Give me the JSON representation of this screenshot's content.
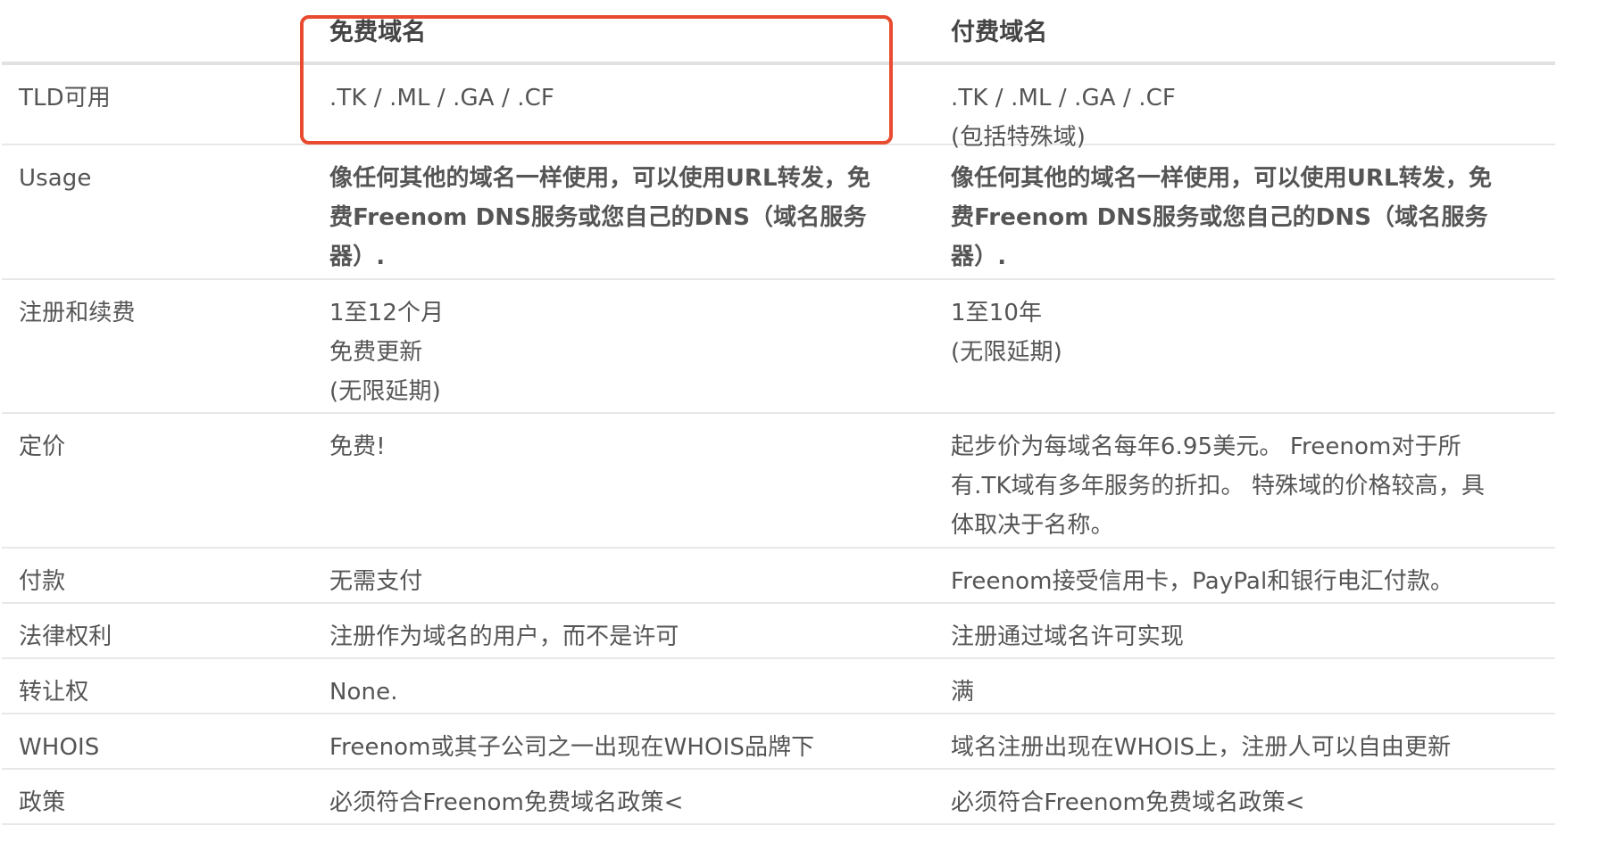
{
  "headers": {
    "label": "",
    "free": "免费域名",
    "paid": "付费域名"
  },
  "rows": [
    {
      "label": "TLD可用",
      "free": [
        ".TK / .ML / .GA / .CF"
      ],
      "paid": [
        ".TK / .ML / .GA / .CF",
        "(包括特殊域)"
      ]
    },
    {
      "label": "Usage",
      "free": [
        "像任何其他的域名一样使用，可以使用URL转发，免",
        "费Freenom DNS服务或您自己的DNS（域名服务",
        "器）."
      ],
      "paid": [
        "像任何其他的域名一样使用，可以使用URL转发，免",
        "费Freenom DNS服务或您自己的DNS（域名服务",
        "器）."
      ]
    },
    {
      "label": "注册和续费",
      "free": [
        "1至12个月",
        "免费更新",
        "(无限延期)"
      ],
      "paid": [
        "1至10年",
        "(无限延期)"
      ]
    },
    {
      "label": "定价",
      "free": [
        "免费!"
      ],
      "paid": [
        "起步价为每域名每年6.95美元。 Freenom对于所",
        "有.TK域有多年服务的折扣。 特殊域的价格较高，具",
        "体取决于名称。"
      ]
    },
    {
      "label": "付款",
      "free": [
        "无需支付"
      ],
      "paid": [
        "Freenom接受信用卡，PayPal和银行电汇付款。"
      ]
    },
    {
      "label": "法律权利",
      "free": [
        "注册作为域名的用户，而不是许可"
      ],
      "paid": [
        "注册通过域名许可实现"
      ]
    },
    {
      "label": "转让权",
      "free": [
        "None."
      ],
      "paid": [
        "满"
      ]
    },
    {
      "label": "WHOIS",
      "free": [
        "Freenom或其子公司之一出现在WHOIS品牌下"
      ],
      "paid": [
        "域名注册出现在WHOIS上，注册人可以自由更新"
      ]
    },
    {
      "label": "政策",
      "free": [
        "必须符合Freenom免费域名政策<"
      ],
      "paid": [
        "必须符合Freenom免费域名政策<"
      ]
    }
  ],
  "annotation": {
    "color": "#e84b2f"
  }
}
